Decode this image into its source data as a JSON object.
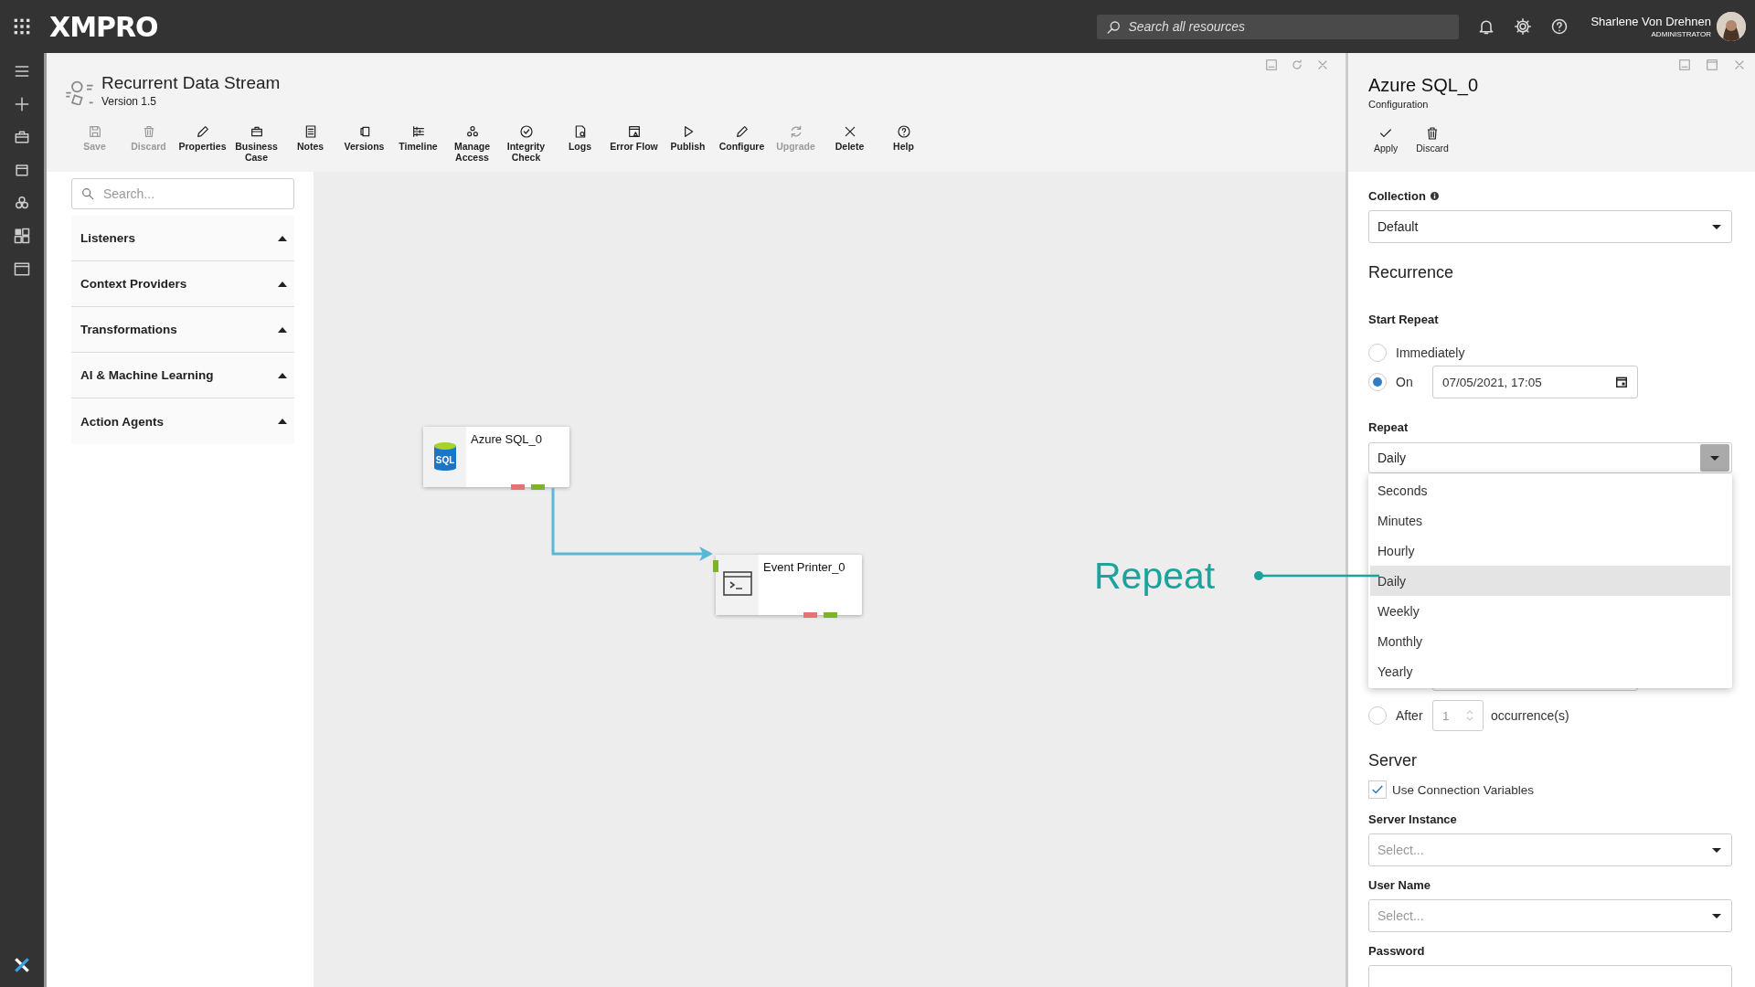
{
  "top_bar": {
    "logo": "XMPRO",
    "search": {
      "placeholder": "Search all resources"
    },
    "user": {
      "name": "Sharlene Von Drehnen",
      "role": "ADMINISTRATOR"
    }
  },
  "stream": {
    "title": "Recurrent Data Stream",
    "version": "Version 1.5"
  },
  "toolbar": [
    {
      "label": "Save",
      "kind": "save",
      "disabled": true
    },
    {
      "label": "Discard",
      "kind": "discard",
      "disabled": true
    },
    {
      "label": "Properties",
      "kind": "properties",
      "disabled": false
    },
    {
      "label": "Business Case",
      "kind": "business",
      "disabled": false
    },
    {
      "label": "Notes",
      "kind": "notes",
      "disabled": false
    },
    {
      "label": "Versions",
      "kind": "versions",
      "disabled": false
    },
    {
      "label": "Timeline",
      "kind": "timeline",
      "disabled": false
    },
    {
      "label": "Manage Access",
      "kind": "access",
      "disabled": false
    },
    {
      "label": "Integrity Check",
      "kind": "integrity",
      "disabled": false
    },
    {
      "label": "Logs",
      "kind": "logs",
      "disabled": false
    },
    {
      "label": "Error Flow",
      "kind": "errorflow",
      "disabled": false
    },
    {
      "label": "Publish",
      "kind": "publish",
      "disabled": false
    },
    {
      "label": "Configure",
      "kind": "configure",
      "disabled": false
    },
    {
      "label": "Upgrade",
      "kind": "upgrade",
      "disabled": true
    },
    {
      "label": "Delete",
      "kind": "delete",
      "disabled": false
    },
    {
      "label": "Help",
      "kind": "help",
      "disabled": false
    }
  ],
  "palette": {
    "search": {
      "placeholder": "Search..."
    },
    "groups": [
      {
        "label": "Listeners"
      },
      {
        "label": "Context Providers"
      },
      {
        "label": "Transformations"
      },
      {
        "label": "AI & Machine Learning"
      },
      {
        "label": "Action Agents"
      }
    ]
  },
  "canvas": {
    "nodes": [
      {
        "name": "Azure SQL_0",
        "kind": "sql",
        "icon_label": "SQL"
      },
      {
        "name": "Event Printer_0",
        "kind": "printer"
      }
    ],
    "callout": "Repeat"
  },
  "config": {
    "title": "Azure SQL_0",
    "subtitle": "Configuration",
    "actions": [
      {
        "label": "Apply",
        "kind": "apply"
      },
      {
        "label": "Discard",
        "kind": "discard"
      }
    ],
    "collection": {
      "label": "Collection",
      "value": "Default"
    },
    "recurrence": {
      "heading": "Recurrence",
      "start_label": "Start Repeat",
      "start_options": [
        {
          "label": "Immediately",
          "selected": false
        },
        {
          "label": "On",
          "selected": true,
          "value": "07/05/2021, 17:05"
        }
      ],
      "repeat_label": "Repeat",
      "repeat_value": "Daily",
      "repeat_options": [
        {
          "label": "Seconds",
          "selected": false
        },
        {
          "label": "Minutes",
          "selected": false
        },
        {
          "label": "Hourly",
          "selected": false
        },
        {
          "label": "Daily",
          "selected": true
        },
        {
          "label": "Weekly",
          "selected": false
        },
        {
          "label": "Monthly",
          "selected": false
        },
        {
          "label": "Yearly",
          "selected": false
        }
      ],
      "end_after": {
        "label": "After",
        "selected": false,
        "value": "1",
        "suffix": "occurrence(s)"
      }
    },
    "server": {
      "heading": "Server",
      "use_connection_variables": {
        "label": "Use Connection Variables",
        "checked": true
      },
      "fields": [
        {
          "label": "Server Instance",
          "placeholder": "Select..."
        },
        {
          "label": "User Name",
          "placeholder": "Select..."
        },
        {
          "label": "Password"
        }
      ]
    }
  }
}
